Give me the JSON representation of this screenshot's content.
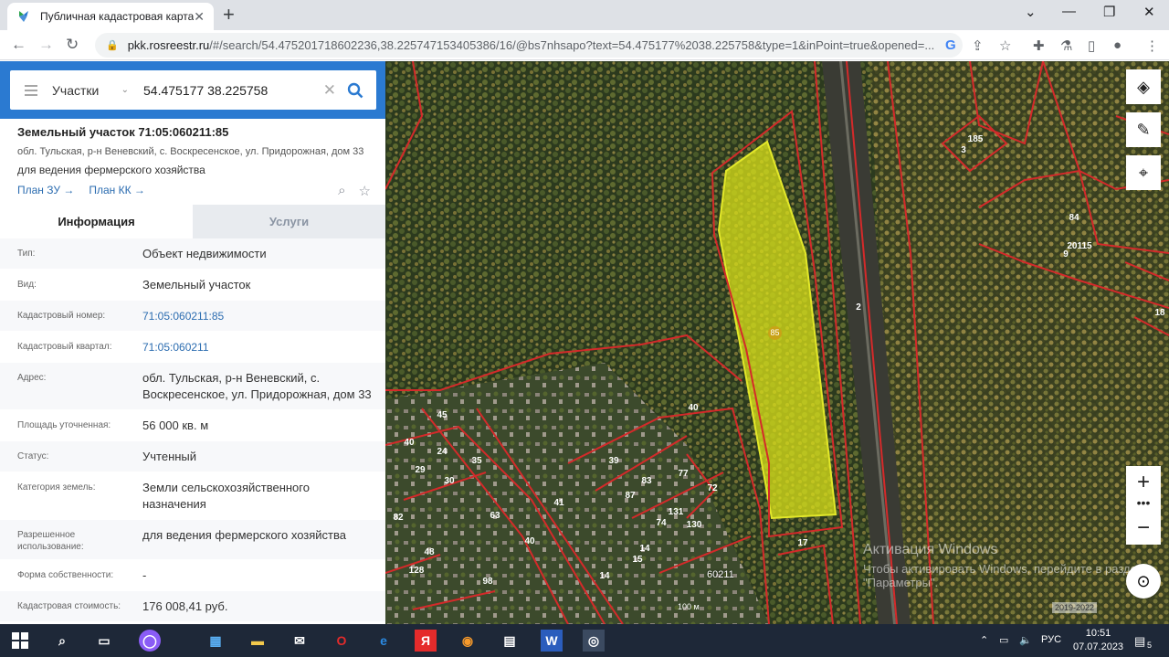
{
  "browser": {
    "tab_title": "Публичная кадастровая карта",
    "tab_close": "✕",
    "new_tab": "+",
    "url_host": "pkk.rosreestr.ru",
    "url_path": "/#/search/54.475201718602236,38.225747153405386/16/@bs7nhsapo?text=54.475177%2038.225758&type=1&inPoint=true&opened=...",
    "window_min": "⌄",
    "window_restore": "—",
    "window_max": "❐",
    "window_close": "✕"
  },
  "search": {
    "category": "Участки",
    "query": "54.475177 38.225758"
  },
  "parcel": {
    "title": "Земельный участок 71:05:060211:85",
    "address_short": "обл. Тульская, р-н Веневский, с. Воскресенское, ул. Придорожная, дом 33",
    "use": "для ведения фермерского хозяйства",
    "plan_zu": "План ЗУ →",
    "plan_kk": "План КК →"
  },
  "tabs": {
    "info": "Информация",
    "services": "Услуги"
  },
  "rows": [
    {
      "k": "Тип:",
      "v": "Объект недвижимости"
    },
    {
      "k": "Вид:",
      "v": "Земельный участок"
    },
    {
      "k": "Кадастровый номер:",
      "v": "71:05:060211:85"
    },
    {
      "k": "Кадастровый квартал:",
      "v": "71:05:060211"
    },
    {
      "k": "Адрес:",
      "v": "обл. Тульская, р-н Веневский, с. Воскресенское, ул. Придорожная, дом 33"
    },
    {
      "k": "Площадь уточненная:",
      "v": "56 000 кв. м"
    },
    {
      "k": "Статус:",
      "v": "Учтенный"
    },
    {
      "k": "Категория земель:",
      "v": "Земли сельскохозяйственного назначения"
    },
    {
      "k": "Разрешенное использование:",
      "v": "для ведения фермерского хозяйства"
    },
    {
      "k": "Форма собственности:",
      "v": "-"
    },
    {
      "k": "Кадастровая стоимость:",
      "v": "176 008,41 руб."
    }
  ],
  "map": {
    "parcel_label": "85",
    "quarter_label": "60211",
    "watermark_title": "Активация Windows",
    "watermark_text": "Чтобы активировать Windows, перейдите в раздел \"Параметры\".",
    "scale": "100 м",
    "copyright": "2019-2022",
    "zoom_in": "+",
    "zoom_out": "−",
    "dots": "•••",
    "labels": [
      "3",
      "185",
      "84",
      "20115",
      "9",
      "2",
      "17",
      "18",
      "45",
      "40",
      "40",
      "39",
      "83",
      "77",
      "72",
      "87",
      "131",
      "130",
      "74",
      "14",
      "15",
      "24",
      "41",
      "35",
      "29",
      "30",
      "63",
      "48",
      "128",
      "40",
      "98",
      "14",
      "82"
    ]
  },
  "taskbar": {
    "lang": "РУС",
    "time": "10:51",
    "date": "07.07.2023",
    "notif_count": "5"
  },
  "colors": {
    "accent": "#2b7ad1",
    "parcel_fill": "#d9e21a",
    "boundary": "#d42a2a"
  }
}
